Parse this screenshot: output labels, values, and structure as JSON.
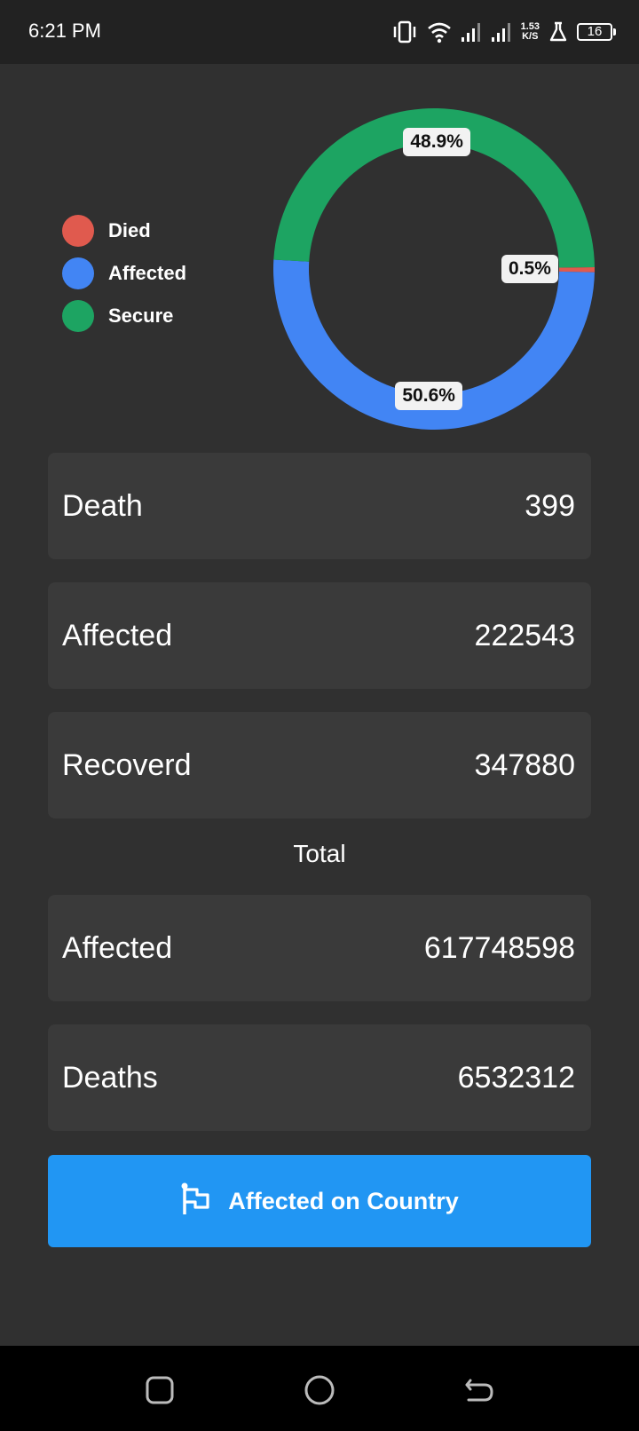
{
  "status_bar": {
    "time": "6:21 PM",
    "net_speed_value": "1.53",
    "net_speed_unit": "K/S",
    "battery": "16"
  },
  "legend": {
    "items": [
      {
        "label": "Died",
        "color": "#e05a4e"
      },
      {
        "label": "Affected",
        "color": "#4285f4"
      },
      {
        "label": "Secure",
        "color": "#1da462"
      }
    ]
  },
  "chart_data": {
    "type": "pie",
    "donut": true,
    "categories": [
      "Died",
      "Affected",
      "Secure"
    ],
    "values": [
      0.5,
      50.6,
      48.9
    ],
    "labels": [
      "0.5%",
      "50.6%",
      "48.9%"
    ],
    "colors": [
      "#e05a4e",
      "#4285f4",
      "#1da462"
    ],
    "legend_position": "left"
  },
  "stats": [
    {
      "label": "Death",
      "value": "399"
    },
    {
      "label": "Affected",
      "value": "222543"
    },
    {
      "label": "Recoverd",
      "value": "347880"
    }
  ],
  "total_heading": "Total",
  "totals": [
    {
      "label": "Affected",
      "value": "617748598"
    },
    {
      "label": "Deaths",
      "value": "6532312"
    }
  ],
  "country_button": {
    "label": "Affected on Country",
    "icon": "flag-icon"
  },
  "nav": {
    "recents": "recents-icon",
    "home": "home-icon",
    "back": "back-icon"
  }
}
